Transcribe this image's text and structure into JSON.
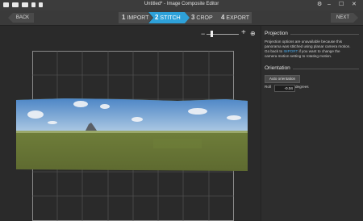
{
  "window": {
    "title": "Untitled* - Image Composite Editor",
    "controls": {
      "minimize": "–",
      "maximize": "☐",
      "close": "✕"
    },
    "title_icons": [
      "new-icon",
      "open-icon",
      "save-icon",
      "export-icon",
      "help-icon"
    ]
  },
  "toolbar": {
    "back_label": "BACK",
    "next_label": "NEXT",
    "steps": [
      {
        "num": "1",
        "label": "IMPORT",
        "active": false
      },
      {
        "num": "2",
        "label": "STITCH",
        "active": true
      },
      {
        "num": "3",
        "label": "CROP",
        "active": false
      },
      {
        "num": "4",
        "label": "EXPORT",
        "active": false
      }
    ]
  },
  "zoom": {
    "minus": "−",
    "plus": "+",
    "level": 0.15
  },
  "projection": {
    "title": "Projection",
    "text1": "Projection options are unavailable because this",
    "text2": "panorama was stitched using planar camera motion.",
    "text3_prefix": "Go back to ",
    "text3_link": "IMPORT",
    "text3_suffix": " if you want to change the",
    "text4": "camera motion setting to rotating motion."
  },
  "orientation": {
    "title": "Orientation",
    "auto_button": "Auto orientation",
    "roll_label": "Roll",
    "roll_value": "-0.04",
    "roll_unit": "degrees"
  },
  "colors": {
    "accent": "#2ea1d9",
    "link": "#4aa8e6",
    "background": "#2b2b2b"
  }
}
